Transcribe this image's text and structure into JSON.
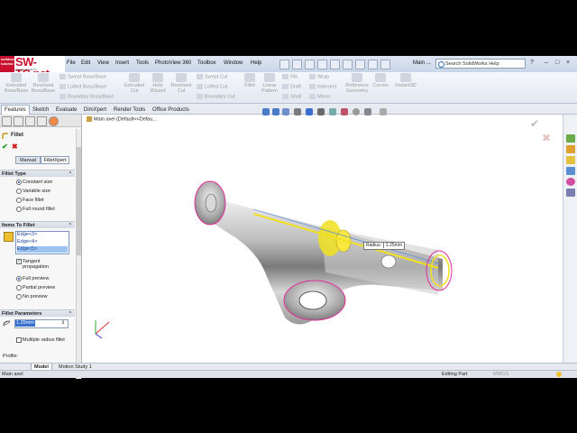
{
  "logo": {
    "brand": "SW-TC.net",
    "badge": "solidworks tutorial",
    "tagline": "tutorials & training"
  },
  "menu": [
    "File",
    "Edit",
    "View",
    "Insert",
    "Tools",
    "PhotoView 360",
    "Toolbox",
    "Window",
    "Help"
  ],
  "doc_short": "Main ...",
  "search_placeholder": "Search SolidWorks Help",
  "commands": {
    "extruded_boss": "Extruded Boss/Base",
    "revolved_boss": "Revolved Boss/Base",
    "swept_boss": "Swept Boss/Base",
    "lofted_boss": "Lofted Boss/Base",
    "boundary_boss": "Boundary Boss/Base",
    "extruded_cut": "Extruded Cut",
    "hole_wizard": "Hole Wizard",
    "revolved_cut": "Revolved Cut",
    "swept_cut": "Swept Cut",
    "lofted_cut": "Lofted Cut",
    "boundary_cut": "Boundary Cut",
    "fillet": "Fillet",
    "linear_pattern": "Linear Pattern",
    "rib": "Rib",
    "draft": "Draft",
    "shell": "Shell",
    "wrap": "Wrap",
    "intersect": "Intersect",
    "mirror": "Mirror",
    "reference_geometry": "Reference Geometry",
    "curves": "Curves",
    "instant3d": "Instant3D"
  },
  "tabs": [
    "Features",
    "Sketch",
    "Evaluate",
    "DimXpert",
    "Render Tools",
    "Office Products"
  ],
  "tree_label": "Main axel  (Default<<Defau...",
  "panel": {
    "title": "Fillet",
    "mode_manual": "Manual",
    "mode_xpert": "FilletXpert",
    "fillet_type_header": "Fillet Type",
    "fillet_types": [
      "Constant size",
      "Variable size",
      "Face fillet",
      "Full round fillet"
    ],
    "items_header": "Items To Fillet",
    "edges": [
      "Edge<3>",
      "Edge<4>",
      "Edge<5>"
    ],
    "tangent_propagation": "Tangent propagation",
    "preview_options": [
      "Full preview",
      "Partial preview",
      "No preview"
    ],
    "params_header": "Fillet Parameters",
    "radius_value": "1.25mm",
    "multiple_radius": "Multiple radius fillet",
    "profile_label": "Profile:"
  },
  "callout": {
    "label": "Radius:",
    "value": "1.25mm"
  },
  "bottom_tabs": [
    "Model",
    "Motion Study 1"
  ],
  "status": {
    "left": "Main axel",
    "right": "Editing Part",
    "units": "MMGS"
  },
  "colors": {
    "accent_red": "#c8102e",
    "preview_yellow": "#f0e020",
    "edge_magenta": "#e0309a"
  }
}
